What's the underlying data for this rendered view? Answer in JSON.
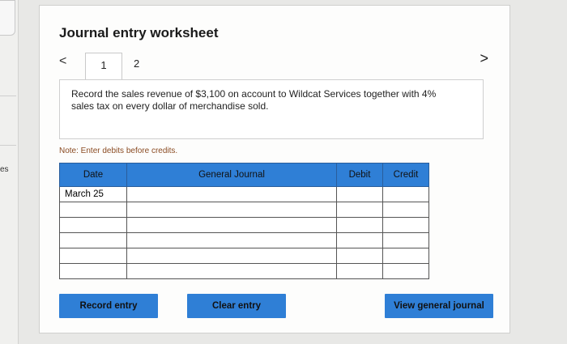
{
  "left_panel": {
    "edge_text": "es"
  },
  "worksheet": {
    "title": "Journal entry worksheet",
    "tabs": [
      {
        "label": "1"
      },
      {
        "label": "2"
      }
    ],
    "prev_symbol": "<",
    "next_symbol": ">",
    "prompt": "Record the sales revenue of $3,100 on account to Wildcat Services together with 4% sales tax on every dollar of merchandise sold.",
    "note": "Note: Enter debits before credits."
  },
  "table": {
    "headers": [
      "Date",
      "General Journal",
      "Debit",
      "Credit"
    ],
    "rows": [
      [
        "March 25",
        "",
        "",
        ""
      ],
      [
        "",
        "",
        "",
        ""
      ],
      [
        "",
        "",
        "",
        ""
      ],
      [
        "",
        "",
        "",
        ""
      ],
      [
        "",
        "",
        "",
        ""
      ],
      [
        "",
        "",
        "",
        ""
      ]
    ]
  },
  "buttons": {
    "record": "Record entry",
    "clear": "Clear entry",
    "view": "View general journal"
  },
  "colors": {
    "accent": "#2f7fd6",
    "note": "#8a4b22"
  }
}
